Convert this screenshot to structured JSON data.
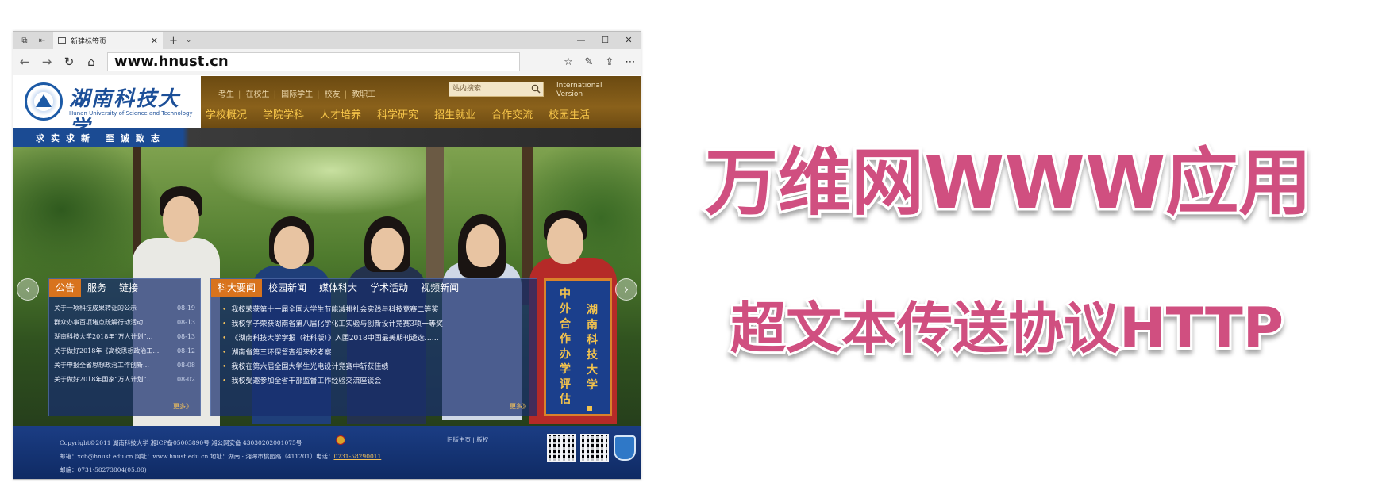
{
  "browser": {
    "tab_title": "新建标签页",
    "url": "www.hnust.cn",
    "window_controls": [
      "—",
      "☐",
      "✕"
    ]
  },
  "site": {
    "name_cn": "湖南科技大学",
    "name_en": "Hunan University of Science and Technology",
    "top_links": [
      "考生",
      "在校生",
      "国际学生",
      "校友",
      "教职工"
    ],
    "search_placeholder": "站内搜索",
    "international": "International Version",
    "main_nav": [
      "学校概况",
      "学院学科",
      "人才培养",
      "科学研究",
      "招生就业",
      "合作交流",
      "校园生活"
    ],
    "motto": "求实求新  至诚致志",
    "notice_tabs": [
      "公告",
      "服务",
      "链接"
    ],
    "notices": [
      {
        "title": "关于一项科技成果转让的公示",
        "date": "08-19"
      },
      {
        "title": "群众办事百项堵点疏解行动活动…",
        "date": "08-13"
      },
      {
        "title": "湖南科技大学2018年“万人计划”…",
        "date": "08-13"
      },
      {
        "title": "关于做好2018年《高校思想政治工…",
        "date": "08-12"
      },
      {
        "title": "关于申报全省思想政治工作创新…",
        "date": "08-08"
      },
      {
        "title": "关于做好2018年国家“万人计划”…",
        "date": "08-02"
      }
    ],
    "notice_more": "更多》",
    "news_tabs": [
      "科大要闻",
      "校园新闻",
      "媒体科大",
      "学术活动",
      "视频新闻"
    ],
    "news": [
      "我校荣获第十一届全国大学生节能减排社会实践与科技竞赛二等奖",
      "我校学子荣获湖南省第八届化学化工实验与创新设计竞赛3项一等奖",
      "《湖南科技大学学报（社科版）》入围2018中国最美期刊遴选……",
      "湖南省第三环保督查组来校考察",
      "我校在第六届全国大学生光电设计竞赛中斩获佳绩",
      "我校受邀参加全省干部监督工作经验交流座谈会"
    ],
    "news_more": "更多》",
    "eval_col1": "中外合作办学评估",
    "eval_col2": "湖南科技大学",
    "footer": {
      "copyright": "Copyright©2011 湖南科技大学 湘ICP备05003890号 湘公网安备 43030202001075号",
      "contact": "邮箱：xcb@hnust.edu.cn 网址：www.hnust.edu.cn 地址：湖南 · 湘潭市桃园路（411201）电话：",
      "phone": "0731-58290011",
      "fax": "邮编：0731-58273804(05.08)",
      "links": "旧版主页  |  版权"
    }
  },
  "slide": {
    "title": "万维网WWW应用",
    "subtitle": "超文本传送协议HTTP",
    "title_color": "#d04f80"
  }
}
